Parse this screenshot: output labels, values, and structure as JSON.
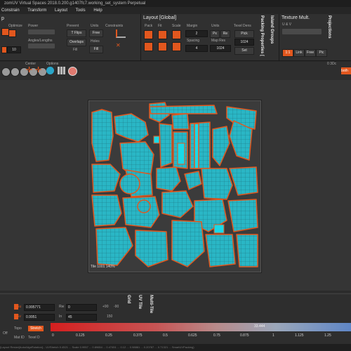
{
  "window": {
    "title": "zomUV  Virtual Spaces 2018.0.200.g1407fc7.working_set_system Perpetual"
  },
  "menu": [
    "Constrain",
    "Transform",
    "Layout",
    "Tools",
    "Help"
  ],
  "toolbar": {
    "left_header": "p",
    "optimize_label": "Optimize",
    "power_label": "Power",
    "angles_label": "Angles/Lengths",
    "iterations_value": "10",
    "prevent_label": "Prevent",
    "tflips_label": "T Flips",
    "overlaps_label": "Overlaps",
    "fill_label": "Fill",
    "units_label": "Units",
    "constraints_label": "Constraints",
    "free_label": "Free",
    "holes_label": "Holes",
    "layout_title": "Layout [Global]",
    "pack_label": "Pack",
    "fit_label": "Fit",
    "scale_label": "Scale",
    "margin_label": "Margin",
    "margin_value": "2",
    "spacing_label": "Spacing",
    "spacing_value": "4",
    "units2_label": "Units",
    "px_label": "Px",
    "re_label": "Re",
    "map_res_label": "Map Res",
    "map_res_value": "1024",
    "map_res_value2": "1024",
    "texel_label": "Texel Dens",
    "pick_label": "Pick",
    "set_label": "Set",
    "texel_value": "1024",
    "packing_tab": "Packing Properties [",
    "island_tab": "Island Groups",
    "texture_title": "Texture Mult.",
    "uv_label": "U & V",
    "onebyone": "1:1",
    "link_label": "Link",
    "free2_label": "Free",
    "pic_label": "Pic",
    "projections_tab": "Projections"
  },
  "iconbar": {
    "center_label": "Center",
    "options_label": "Options",
    "right_value": "0 3Dc",
    "right_tab": "both"
  },
  "viewport": {
    "tile_label": "Tile 1001 140%"
  },
  "bottom": {
    "su_label": "Su",
    "su_value": "0.995771",
    "sv_label": "Sv",
    "sv_value": "0.9951",
    "rw_label": "Rw",
    "rw_value": "0",
    "in_label": "In",
    "in_value": "45",
    "plus90": "+90",
    "minus90": "-90",
    "val150": "150",
    "grid_tab": "Grid",
    "uvtile_tab": "UV Tile",
    "multitile_tab": "Multi-Tile",
    "off_label": "Off",
    "topo_label": "Topo",
    "stretch_label": "Stretch",
    "matid_label": "Mat ID",
    "texel_d_label": "Texel D",
    "level_label": "33.444",
    "ticks": [
      "0",
      "0.125",
      "0.25",
      "0.375",
      "0.5",
      "0.625",
      "0.75",
      "0.875",
      "1",
      "1.125",
      "1.25"
    ],
    "statusline": "(Layout Resize[AutoAlignRotation]... UVStretch 0.4521 ... Scale 0.9957 ... 0.89654 ... 0.47451 ... 0.12 ... 0.98881 ... 0.20787 ... 0.71321 ... SmartUVPacking)"
  },
  "colors": {
    "accent": "#e2571e",
    "island_fill": "#2ab6c5",
    "island_edge": "#e2571e"
  }
}
